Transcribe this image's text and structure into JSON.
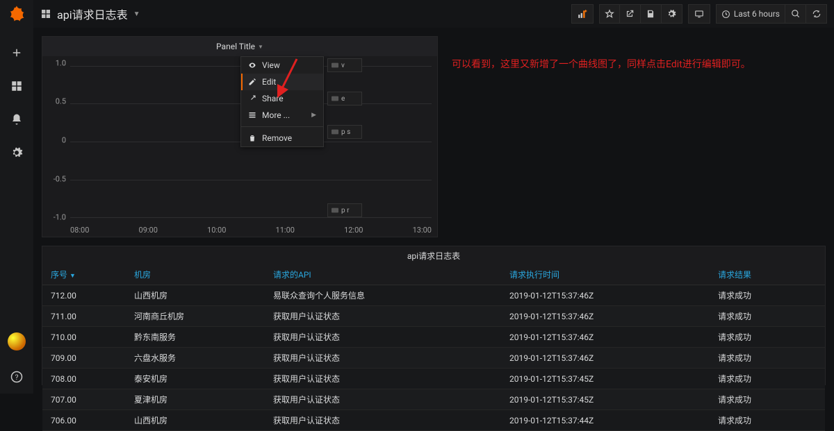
{
  "header": {
    "title": "api请求日志表"
  },
  "toolbar": {
    "time_label": "Last 6 hours"
  },
  "annotation": "可以看到，这里又新增了一个曲线图了，同样点击Edit进行编辑即可。",
  "panel": {
    "title": "Panel Title",
    "menu": {
      "view": "View",
      "edit": "Edit",
      "share": "Share",
      "more": "More ...",
      "remove": "Remove",
      "sc_view": "v",
      "sc_edit": "e",
      "sc_share": "p s",
      "sc_remove": "p r"
    }
  },
  "chart_data": {
    "type": "line",
    "title": "Panel Title",
    "series": [],
    "x_ticks": [
      "08:00",
      "09:00",
      "10:00",
      "11:00",
      "12:00",
      "13:00"
    ],
    "y_ticks": [
      "1.0",
      "0.5",
      "0",
      "-0.5",
      "-1.0"
    ],
    "xlim": [
      "08:00",
      "13:00"
    ],
    "ylim": [
      -1.0,
      1.0
    ],
    "grid": true
  },
  "table": {
    "title": "api请求日志表",
    "columns": [
      "序号",
      "机房",
      "请求的API",
      "请求执行时间",
      "请求结果"
    ],
    "sort_col": 0,
    "rows": [
      {
        "seq": "712.00",
        "room": "山西机房",
        "api": "易联众查询个人服务信息",
        "time": "2019-01-12T15:37:46Z",
        "result": "请求成功"
      },
      {
        "seq": "711.00",
        "room": "河南商丘机房",
        "api": "获取用户认证状态",
        "time": "2019-01-12T15:37:46Z",
        "result": "请求成功"
      },
      {
        "seq": "710.00",
        "room": "黔东南服务",
        "api": "获取用户认证状态",
        "time": "2019-01-12T15:37:46Z",
        "result": "请求成功"
      },
      {
        "seq": "709.00",
        "room": "六盘水服务",
        "api": "获取用户认证状态",
        "time": "2019-01-12T15:37:46Z",
        "result": "请求成功"
      },
      {
        "seq": "708.00",
        "room": "泰安机房",
        "api": "获取用户认证状态",
        "time": "2019-01-12T15:37:45Z",
        "result": "请求成功"
      },
      {
        "seq": "707.00",
        "room": "夏津机房",
        "api": "获取用户认证状态",
        "time": "2019-01-12T15:37:45Z",
        "result": "请求成功"
      },
      {
        "seq": "706.00",
        "room": "山西机房",
        "api": "获取用户认证状态",
        "time": "2019-01-12T15:37:44Z",
        "result": "请求成功"
      }
    ]
  }
}
